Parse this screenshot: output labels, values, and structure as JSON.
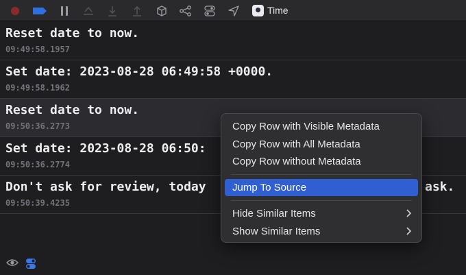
{
  "toolbar": {
    "scheme_label": "Time",
    "icons": [
      "record-icon",
      "tag-icon",
      "pause-icon",
      "share-icon",
      "download-icon",
      "upload-icon",
      "cube-icon",
      "graph-icon",
      "toggle-icon",
      "location-arrow-icon"
    ]
  },
  "log": {
    "rows": [
      {
        "message": "Reset date to now.",
        "timestamp": "09:49:58.1957"
      },
      {
        "message": "Set date: 2023-08-28 06:49:58 +0000.",
        "timestamp": "09:49:58.1962"
      },
      {
        "message": "Reset date to now.",
        "timestamp": "09:50:36.2773"
      },
      {
        "message": "Set date: 2023-08-28 06:50:",
        "timestamp": "09:50:36.2774"
      },
      {
        "message": "Don't ask for review, today",
        "message_tail": "ask.",
        "timestamp": "09:50:39.4235"
      }
    ]
  },
  "context_menu": {
    "items": [
      {
        "label": "Copy Row with Visible Metadata"
      },
      {
        "label": "Copy Row with All Metadata"
      },
      {
        "label": "Copy Row without Metadata"
      },
      {
        "label": "Jump To Source"
      },
      {
        "label": "Hide Similar Items"
      },
      {
        "label": "Show Similar Items"
      }
    ]
  },
  "colors": {
    "record": "#8a2a2a",
    "tag": "#2f6fe0",
    "selection": "#2f5fd0"
  }
}
